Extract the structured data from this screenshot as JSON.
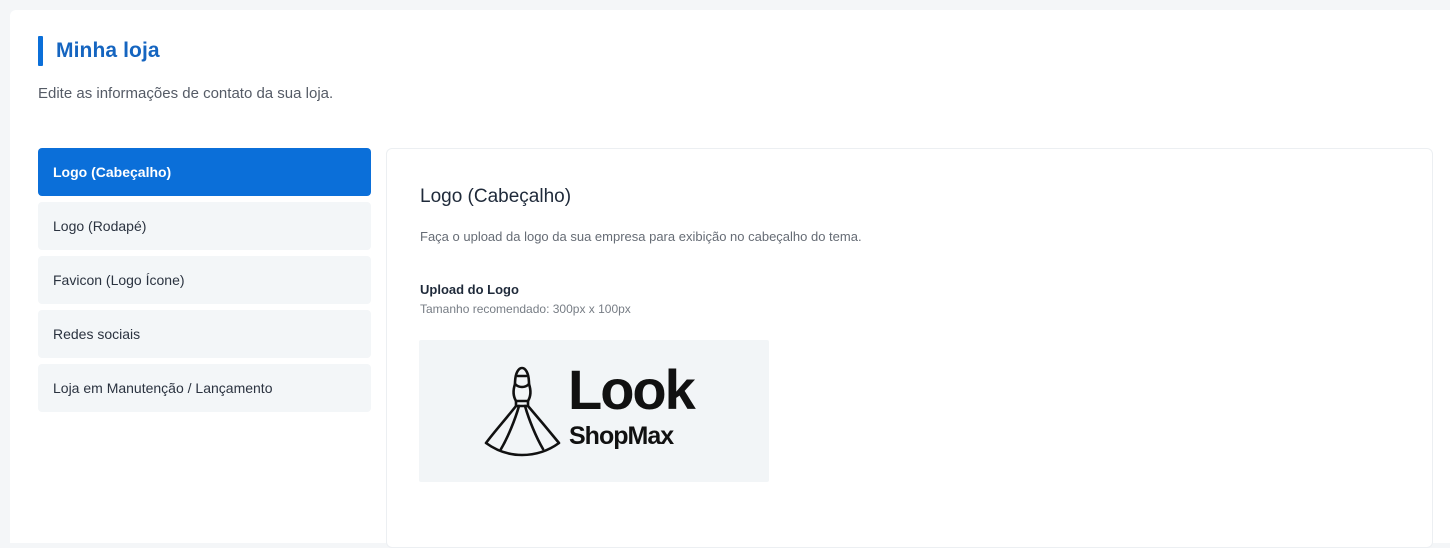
{
  "header": {
    "title": "Minha loja",
    "subtitle": "Edite as informações de contato da sua loja."
  },
  "menu": {
    "items": [
      {
        "label": "Logo (Cabeçalho)",
        "active": true
      },
      {
        "label": "Logo (Rodapé)",
        "active": false
      },
      {
        "label": "Favicon (Logo Ícone)",
        "active": false
      },
      {
        "label": "Redes sociais",
        "active": false
      },
      {
        "label": "Loja em Manutenção / Lançamento",
        "active": false
      }
    ]
  },
  "panel": {
    "title": "Logo (Cabeçalho)",
    "description": "Faça o upload da logo da sua empresa para exibição no cabeçalho do tema.",
    "upload_label": "Upload do Logo",
    "upload_hint": "Tamanho recomendado: 300px x 100px",
    "logo": {
      "icon": "dress-icon",
      "brand_main": "Look",
      "brand_sub": "ShopMax"
    }
  },
  "colors": {
    "accent": "#0b6fd9",
    "title": "#1565c0",
    "menu_bg": "#f3f6f8",
    "logo_bg": "#f2f5f7"
  }
}
